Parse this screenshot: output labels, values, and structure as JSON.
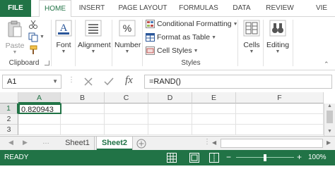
{
  "ribbon_tabs": [
    "FILE",
    "HOME",
    "INSERT",
    "PAGE LAYOUT",
    "FORMULAS",
    "DATA",
    "REVIEW",
    "VIE"
  ],
  "clipboard": {
    "paste_label": "Paste",
    "group_label": "Clipboard"
  },
  "font": {
    "label": "Font"
  },
  "alignment": {
    "label": "Alignment"
  },
  "number": {
    "label": "Number",
    "icon_text": "%"
  },
  "styles": {
    "conditional_formatting": "Conditional Formatting",
    "format_as_table": "Format as Table",
    "cell_styles": "Cell Styles",
    "group_label": "Styles"
  },
  "cells": {
    "label": "Cells"
  },
  "editing": {
    "label": "Editing"
  },
  "font_icon_letter": "A",
  "formula_bar": {
    "name_box": "A1",
    "formula": "=RAND()",
    "fx_label": "fx"
  },
  "grid": {
    "columns": [
      "A",
      "B",
      "C",
      "D",
      "E",
      "F"
    ],
    "rows": [
      "1",
      "2",
      "3"
    ],
    "cells": {
      "A1": "0.820943"
    }
  },
  "sheet_tabs": [
    "Sheet1",
    "Sheet2"
  ],
  "active_sheet": "Sheet2",
  "status": {
    "ready": "READY",
    "zoom": "100%"
  },
  "colors": {
    "excel_green": "#217346",
    "accent_blue": "#2b579a"
  }
}
